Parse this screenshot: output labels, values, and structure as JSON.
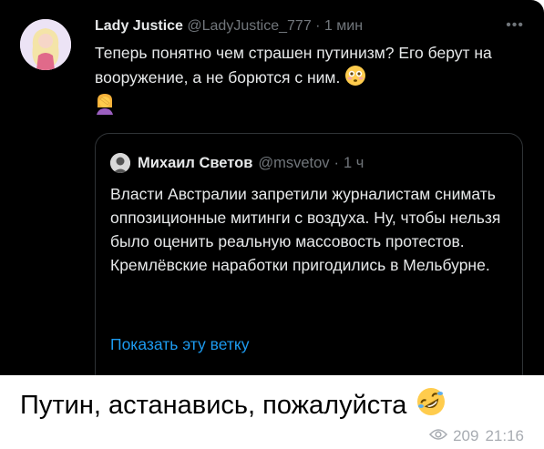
{
  "tweet": {
    "author_name": "Lady Justice",
    "author_handle": "@LadyJustice_777",
    "separator": "·",
    "time": "1 мин",
    "text": "Теперь понятно чем страшен путинизм? Его берут на вооружение, а не борются с ним.",
    "emojis": [
      "flushed-face-emoji",
      "woman-facepalming-emoji"
    ]
  },
  "quote": {
    "author_name": "Михаил Светов",
    "author_handle": "@msvetov",
    "separator": "·",
    "time": "1 ч",
    "text": "Власти Австралии запретили журналистам снимать оппозиционные митинги с воздуха. Ну, чтобы нельзя было оценить реальную массовость протестов. Кремлёвские наработки пригодились в Мельбурне.",
    "show_thread_label": "Показать эту ветку"
  },
  "message": {
    "caption": "Путин, астанавись, пожалуйста",
    "caption_emoji": "rolling-on-floor-laughing-emoji",
    "views": "209",
    "time": "21:16"
  },
  "colors": {
    "card_background": "#000000",
    "primary_text": "#e7e9ea",
    "secondary_text": "#71767b",
    "link": "#1d9bf0",
    "quote_border": "#2f3336",
    "meta_text": "#a8acb2"
  }
}
